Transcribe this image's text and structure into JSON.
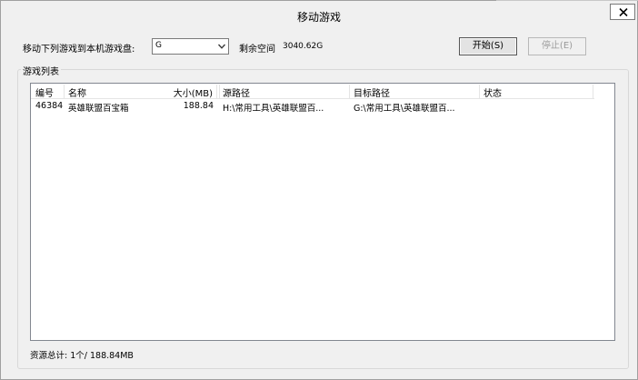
{
  "window": {
    "title": "移动游戏"
  },
  "toolbar": {
    "target_drive_label": "移动下列游戏到本机游戏盘:",
    "target_drive_value": "G",
    "free_space_label": "剩余空间",
    "free_space_value": "3040.62G",
    "start_label": "开始(S)",
    "stop_label": "停止(E)"
  },
  "game_list": {
    "group_title": "游戏列表",
    "columns": [
      "编号",
      "名称",
      "大小(MB)",
      "源路径",
      "目标路径",
      "状态"
    ],
    "rows": [
      {
        "id": "46384",
        "name": "英雄联盟百宝箱",
        "size": "188.84",
        "source": "H:\\常用工具\\英雄联盟百...",
        "target": "G:\\常用工具\\英雄联盟百...",
        "status": ""
      }
    ]
  },
  "summary": {
    "text": "资源总计: 1个/ 188.84MB"
  },
  "icons": {
    "close": "close-icon",
    "dropdown": "chevron-down-icon"
  }
}
